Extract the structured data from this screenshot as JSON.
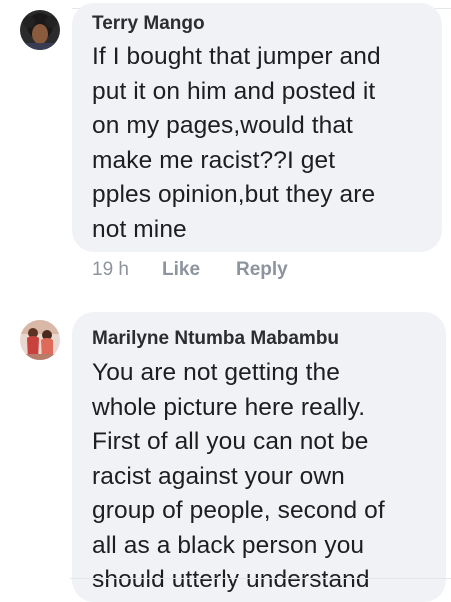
{
  "comments": [
    {
      "author": "Terry Mango",
      "text_lines": [
        "If I bought that jumper and",
        "put it on him and posted it",
        "on my pages,would that",
        "make me racist??I get",
        "pples opinion,but they are",
        "not mine"
      ],
      "time": "19 h",
      "like_label": "Like",
      "reply_label": "Reply"
    },
    {
      "author": "Marilyne Ntumba Mabambu",
      "text_lines": [
        "You are not getting the",
        "whole picture here really.",
        "First of all you can not be",
        "racist against your own",
        "group of people, second of",
        "all as a black person you",
        "should utterly understand"
      ]
    }
  ],
  "colors": {
    "bubble": "#f0f2f5",
    "text": "#1c1e21",
    "meta": "#8d949e"
  }
}
